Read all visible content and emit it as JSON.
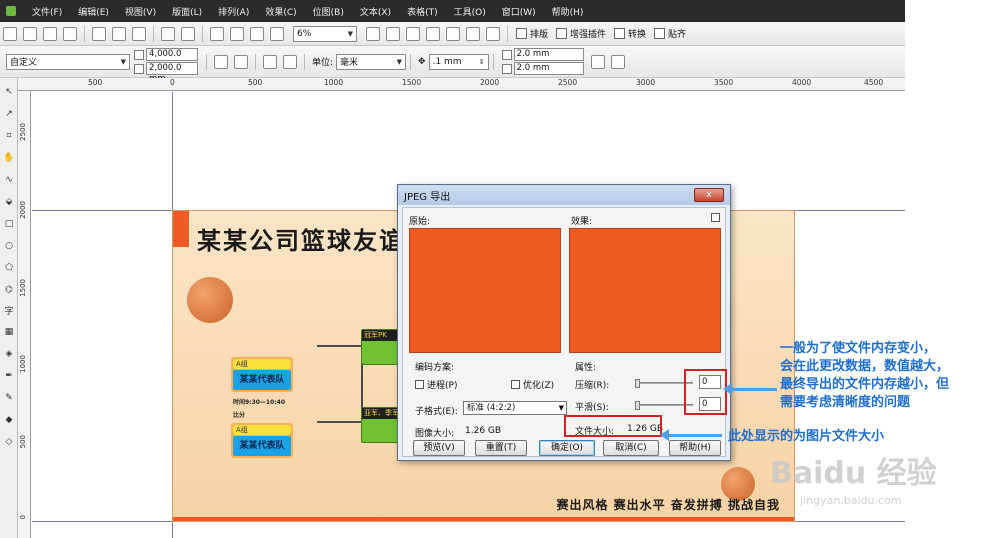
{
  "menu": [
    "文件(F)",
    "编辑(E)",
    "视图(V)",
    "版面(L)",
    "排列(A)",
    "效果(C)",
    "位图(B)",
    "文本(X)",
    "表格(T)",
    "工具(O)",
    "窗口(W)",
    "帮助(H)"
  ],
  "toolbar1": {
    "zoom_value": "6%",
    "plugins": [
      "排版",
      "增强插件",
      "转换",
      "贴齐"
    ]
  },
  "toolbar2": {
    "preset": "自定义",
    "width": "4,000.0 mm",
    "height": "2,000.0 mm",
    "unit_label": "单位:",
    "unit_value": "毫米",
    "nudge": ".1 mm",
    "dup_x": "2.0 mm",
    "dup_y": "2.0 mm"
  },
  "ruler": {
    "h_ticks": [
      "500",
      "0",
      "500",
      "1000",
      "1500",
      "2000",
      "2500",
      "3000",
      "3500",
      "4000",
      "4500"
    ],
    "v_ticks": [
      "2500",
      "2000",
      "1500",
      "1000",
      "500",
      "0"
    ]
  },
  "poster": {
    "title": "某某公司篮球友谊",
    "card1_group": "A组",
    "card1_team": "某某代表队",
    "match_time": "时间9:30—10:40",
    "score_label": "比分",
    "card2_group": "A组",
    "card2_team": "某某代表队",
    "green1_label": "冠军PK",
    "green2_label": "亚军、季军",
    "slogan": "赛出风格  赛出水平  奋发拼搏  挑战自我"
  },
  "dialog": {
    "title": "JPEG 导出",
    "close_label": "x",
    "original_label": "原始:",
    "result_label": "效果:",
    "encoding_label": "编码方案:",
    "progressive_label": "进程(P)",
    "optimize_label": "优化(Z)",
    "subformat_label": "子格式(E):",
    "subformat_value": "标准 (4:2:2)",
    "image_size_label": "图像大小:",
    "image_size_value": "1.26 GB",
    "properties_label": "属性:",
    "compress_label": "压缩(R):",
    "compress_value": "0",
    "smooth_label": "平滑(S):",
    "smooth_value": "0",
    "file_size_label": "文件大小:",
    "file_size_value": "1.26 GB",
    "buttons": {
      "preview": "预览(V)",
      "reset": "重置(T)",
      "ok": "确定(O)",
      "cancel": "取消(C)",
      "help": "帮助(H)"
    }
  },
  "annotations": {
    "note1_line1": "一般为了使文件内存变小，",
    "note1_line2": "会在此更改数据，数值越大，",
    "note1_line3": "最终导出的文件内存越小，但",
    "note1_line4": "需要考虑清晰度的问题",
    "note2": "此处显示的为图片文件大小"
  },
  "watermark": {
    "brand": "Baidu 经验",
    "url": "jingyan.baidu.com"
  },
  "colors": {
    "preview_fill": "#ef5a22",
    "annotation_text": "#1e6fcf",
    "highlight_box": "#d42222"
  }
}
